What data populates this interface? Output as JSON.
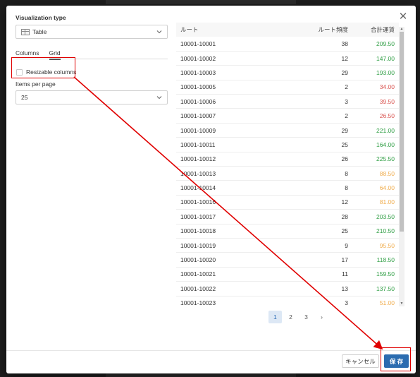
{
  "panel": {
    "visualization_label": "Visualization type",
    "visualization_value": "Table",
    "tabs": [
      {
        "label": "Columns",
        "active": false
      },
      {
        "label": "Grid",
        "active": true
      }
    ],
    "resizable_label": "Resizable columns",
    "resizable_checked": false,
    "items_per_page_label": "Items per page",
    "items_per_page_value": "25"
  },
  "table": {
    "headers": [
      "ルート",
      "ルート頻度",
      "合計運賃"
    ],
    "rows": [
      {
        "route": "10001-10001",
        "freq": "38",
        "total": "209.50",
        "color": "green"
      },
      {
        "route": "10001-10002",
        "freq": "12",
        "total": "147.00",
        "color": "green"
      },
      {
        "route": "10001-10003",
        "freq": "29",
        "total": "193.00",
        "color": "green"
      },
      {
        "route": "10001-10005",
        "freq": "2",
        "total": "34.00",
        "color": "red"
      },
      {
        "route": "10001-10006",
        "freq": "3",
        "total": "39.50",
        "color": "red"
      },
      {
        "route": "10001-10007",
        "freq": "2",
        "total": "26.50",
        "color": "red"
      },
      {
        "route": "10001-10009",
        "freq": "29",
        "total": "221.00",
        "color": "green"
      },
      {
        "route": "10001-10011",
        "freq": "25",
        "total": "164.00",
        "color": "green"
      },
      {
        "route": "10001-10012",
        "freq": "26",
        "total": "225.50",
        "color": "green"
      },
      {
        "route": "10001-10013",
        "freq": "8",
        "total": "88.50",
        "color": "yellow"
      },
      {
        "route": "10001-10014",
        "freq": "8",
        "total": "64.00",
        "color": "yellow"
      },
      {
        "route": "10001-10016",
        "freq": "12",
        "total": "81.00",
        "color": "yellow"
      },
      {
        "route": "10001-10017",
        "freq": "28",
        "total": "203.50",
        "color": "green"
      },
      {
        "route": "10001-10018",
        "freq": "25",
        "total": "210.50",
        "color": "green"
      },
      {
        "route": "10001-10019",
        "freq": "9",
        "total": "95.50",
        "color": "yellow"
      },
      {
        "route": "10001-10020",
        "freq": "17",
        "total": "118.50",
        "color": "green"
      },
      {
        "route": "10001-10021",
        "freq": "11",
        "total": "159.50",
        "color": "green"
      },
      {
        "route": "10001-10022",
        "freq": "13",
        "total": "137.50",
        "color": "green"
      },
      {
        "route": "10001-10023",
        "freq": "3",
        "total": "51.00",
        "color": "yellow"
      }
    ]
  },
  "pagination": {
    "pages": [
      "1",
      "2",
      "3"
    ],
    "current": "1",
    "next": "›"
  },
  "footer": {
    "cancel_label": "キャンセル",
    "save_label": "保 存"
  },
  "icons": {
    "close": "close-icon",
    "chevron": "chevron-down-icon",
    "table": "table-icon"
  },
  "colors": {
    "green": "#2f9e44",
    "red": "#d9534f",
    "yellow": "#f0ad4e",
    "primary": "#2b6cb0",
    "annotation": "#e00000"
  }
}
